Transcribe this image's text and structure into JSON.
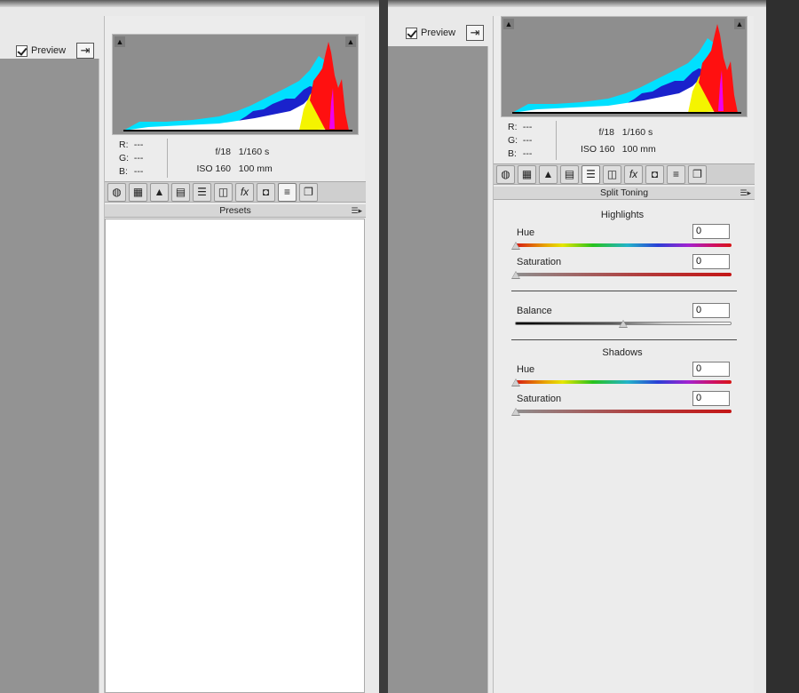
{
  "left": {
    "preview_label": "Preview",
    "info": {
      "r_label": "R:",
      "g_label": "G:",
      "b_label": "B:",
      "r": "---",
      "g": "---",
      "b": "---",
      "aperture": "f/18",
      "shutter": "1/160 s",
      "iso": "ISO 160",
      "focal": "100 mm"
    },
    "panel_title": "Presets",
    "tabs": [
      "basic-icon",
      "tone-curve-icon",
      "detail-icon",
      "hsl-icon",
      "split-toning-icon",
      "lens-corrections-icon",
      "effects-icon",
      "camera-calibration-icon",
      "presets-icon",
      "snapshots-icon"
    ],
    "active_tab": 8
  },
  "right": {
    "preview_label": "Preview",
    "info": {
      "r_label": "R:",
      "g_label": "G:",
      "b_label": "B:",
      "r": "---",
      "g": "---",
      "b": "---",
      "aperture": "f/18",
      "shutter": "1/160 s",
      "iso": "ISO 160",
      "focal": "100 mm"
    },
    "panel_title": "Split Toning",
    "tabs": [
      "basic-icon",
      "tone-curve-icon",
      "detail-icon",
      "hsl-icon",
      "split-toning-icon",
      "lens-corrections-icon",
      "effects-icon",
      "camera-calibration-icon",
      "presets-icon",
      "snapshots-icon"
    ],
    "active_tab": 4,
    "highlights": {
      "title": "Highlights",
      "hue_label": "Hue",
      "hue": "0",
      "saturation_label": "Saturation",
      "saturation": "0"
    },
    "balance": {
      "label": "Balance",
      "value": "0"
    },
    "shadows": {
      "title": "Shadows",
      "hue_label": "Hue",
      "hue": "0",
      "saturation_label": "Saturation",
      "saturation": "0"
    }
  },
  "colors": {
    "canvas": "#939393",
    "panel": "#ececec",
    "histogram_bg": "#8e8e8e"
  }
}
